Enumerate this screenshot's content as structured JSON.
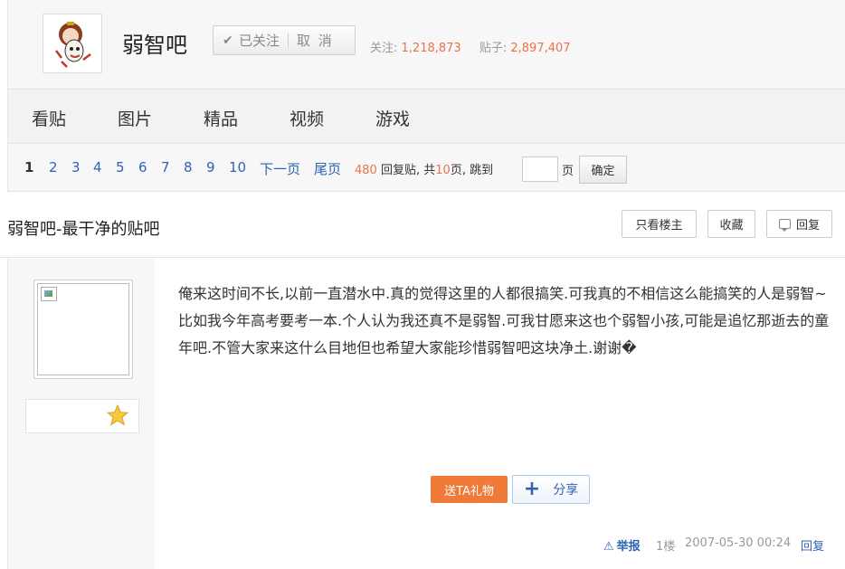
{
  "forum": {
    "name": "弱智吧",
    "followed_label": "已关注",
    "cancel_label": "取 消",
    "followers_label": "关注:",
    "followers_count": "1,218,873",
    "posts_label": "贴子:",
    "posts_count": "2,897,407",
    "check_glyph": "✔"
  },
  "nav": {
    "tabs": [
      "看贴",
      "图片",
      "精品",
      "视频",
      "游戏"
    ]
  },
  "pager": {
    "pages": [
      "1",
      "2",
      "3",
      "4",
      "5",
      "6",
      "7",
      "8",
      "9",
      "10"
    ],
    "next_label": "下一页",
    "last_label": "尾页",
    "reply_count": "480",
    "reply_label": "回复贴,",
    "total_prefix": "共",
    "total_pages": "10",
    "total_suffix": "页,",
    "jump_label": "跳到",
    "page_unit": "页",
    "ok_label": "确定",
    "colors": {
      "link": "#2d64b3",
      "highlight": "#e9734a"
    }
  },
  "thread": {
    "title": "弱智吧-最干净的贴吧",
    "only_op_label": "只看楼主",
    "favorite_label": "收藏",
    "reply_label": "回复"
  },
  "post": {
    "text": "俺来这时间不长,以前一直潜水中.真的觉得这里的人都很搞笑.可我真的不相信这么能搞笑的人是弱智~比如我今年高考要考一本.个人认为我还真不是弱智.可我甘愿来这也个弱智小孩,可能是追忆那逝去的童年吧.不管大家来这什么目地但也希望大家能珍惜弱智吧这块净土.谢谢�",
    "gift_label": "送TA礼物",
    "share_label": "分享",
    "report_label": "举报",
    "floor": "1楼",
    "time": "2007-05-30 00:24",
    "reply_label": "回复",
    "badge_icon": "star-icon",
    "gift_color": "#f07a38"
  }
}
